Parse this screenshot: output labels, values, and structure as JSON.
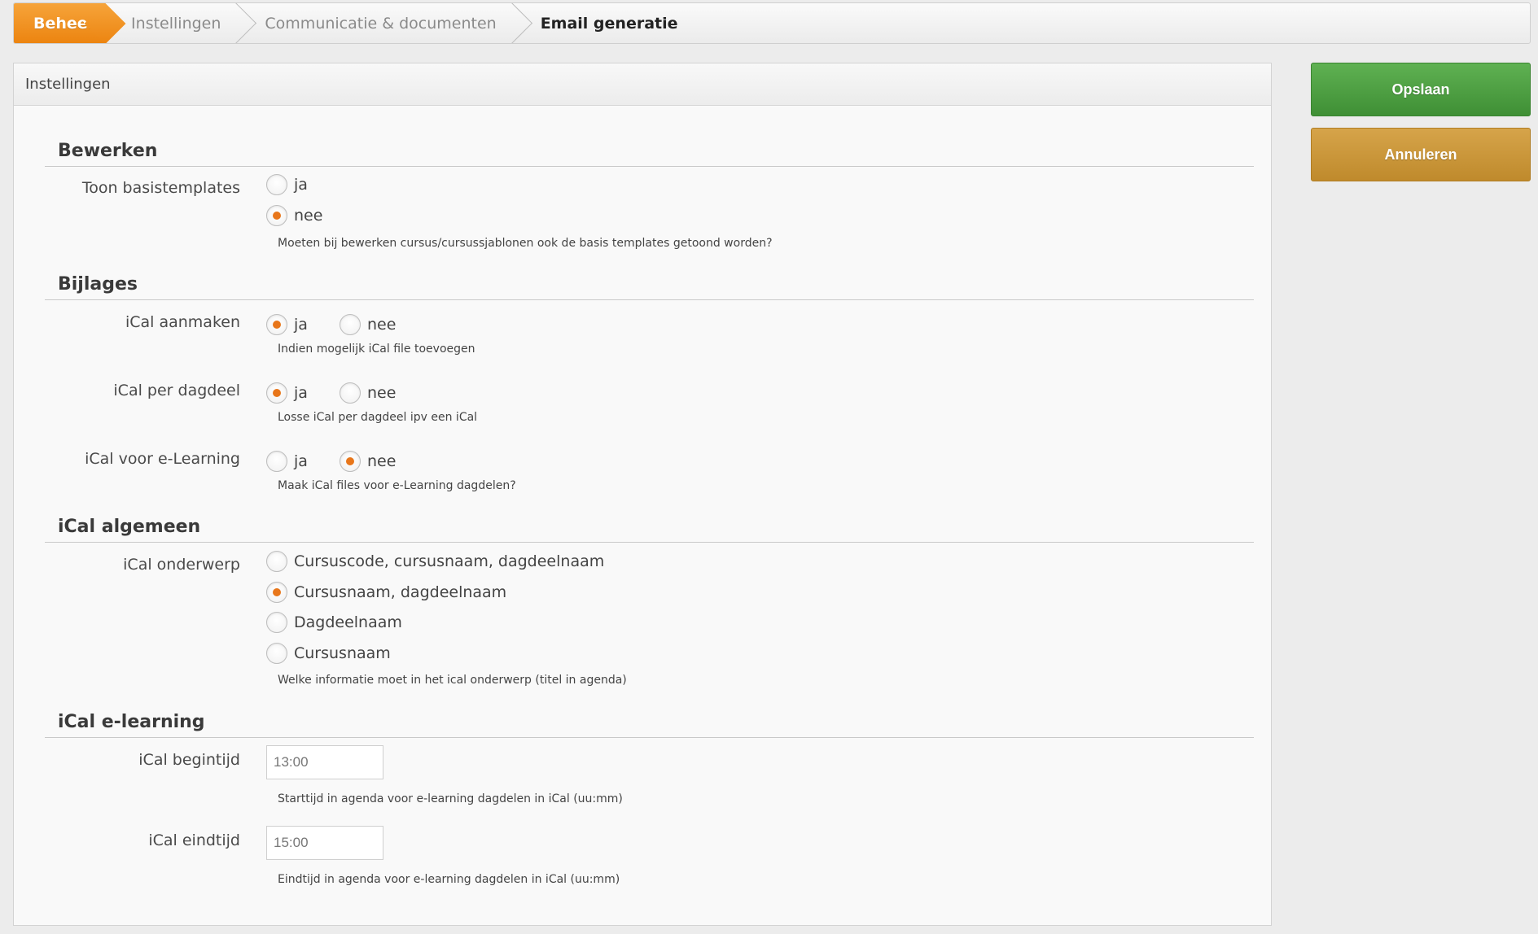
{
  "breadcrumb": {
    "items": [
      {
        "label": "Beheer"
      },
      {
        "label": "Instellingen"
      },
      {
        "label": "Communicatie & documenten"
      },
      {
        "label": "Email generatie"
      }
    ]
  },
  "panel": {
    "title": "Instellingen"
  },
  "sections": {
    "bewerken": {
      "title": "Bewerken",
      "toon_basistemplates": {
        "label": "Toon basistemplates",
        "options": [
          "ja",
          "nee"
        ],
        "selected": "nee",
        "help": "Moeten bij bewerken cursus/cursussjablonen ook de basis templates getoond worden?"
      }
    },
    "bijlages": {
      "title": "Bijlages",
      "ical_aanmaken": {
        "label": "iCal aanmaken",
        "options": [
          "ja",
          "nee"
        ],
        "selected": "ja",
        "help": "Indien mogelijk iCal file toevoegen"
      },
      "ical_per_dagdeel": {
        "label": "iCal per dagdeel",
        "options": [
          "ja",
          "nee"
        ],
        "selected": "ja",
        "help": "Losse iCal per dagdeel ipv een iCal"
      },
      "ical_voor_elearning": {
        "label": "iCal voor e-Learning",
        "options": [
          "ja",
          "nee"
        ],
        "selected": "nee",
        "help": "Maak iCal files voor e-Learning dagdelen?"
      }
    },
    "ical_algemeen": {
      "title": "iCal algemeen",
      "ical_onderwerp": {
        "label": "iCal onderwerp",
        "options": [
          "Cursuscode, cursusnaam, dagdeelnaam",
          "Cursusnaam, dagdeelnaam",
          "Dagdeelnaam",
          "Cursusnaam"
        ],
        "selected": "Cursusnaam, dagdeelnaam",
        "help": "Welke informatie moet in het ical onderwerp (titel in agenda)"
      }
    },
    "ical_elearning": {
      "title": "iCal e-learning",
      "begintijd": {
        "label": "iCal begintijd",
        "value": "13:00",
        "help": "Starttijd in agenda voor e-learning dagdelen in iCal (uu:mm)"
      },
      "eindtijd": {
        "label": "iCal eindtijd",
        "value": "15:00",
        "help": "Eindtijd in agenda voor e-learning dagdelen in iCal (uu:mm)"
      }
    }
  },
  "actions": {
    "save_label": "Opslaan",
    "cancel_label": "Annuleren"
  },
  "colors": {
    "accent_orange": "#ec8410",
    "save_green": "#4aa03f",
    "cancel_gold": "#c8952f"
  }
}
